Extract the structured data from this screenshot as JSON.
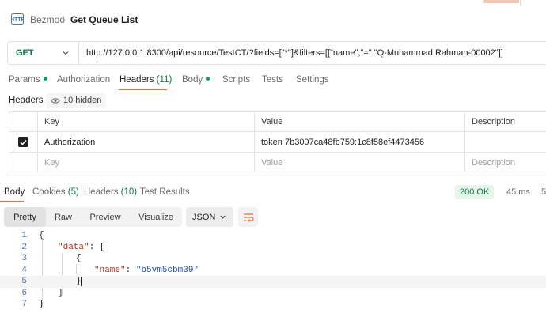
{
  "breadcrumb": {
    "workspace": "Bezmoo",
    "separator": "/",
    "title": "Get Queue List"
  },
  "request": {
    "method": "GET",
    "url": "http://127.0.0.1:8300/api/resource/TestCT/?fields=[\"*\"]&filters=[[\"name\",\"=\",\"Q-Muhammad Rahman-00002\"]]"
  },
  "request_tabs": {
    "params": "Params",
    "authorization": "Authorization",
    "headers": "Headers",
    "headers_count": "(11)",
    "body": "Body",
    "scripts": "Scripts",
    "tests": "Tests",
    "settings": "Settings"
  },
  "headers_section": {
    "label": "Headers",
    "hidden": "10 hidden",
    "columns": {
      "key": "Key",
      "value": "Value",
      "description": "Description"
    },
    "rows": [
      {
        "checked": true,
        "key": "Authorization",
        "value": "token 7b3007ca48fb759:1c8f58ef4473456",
        "description": ""
      }
    ],
    "new_row": {
      "key_placeholder": "Key",
      "value_placeholder": "Value",
      "description_placeholder": "Description"
    }
  },
  "response_tabs": {
    "body": "Body",
    "cookies": "Cookies",
    "cookies_count": "(5)",
    "headers": "Headers",
    "headers_count": "(10)",
    "test_results": "Test Results"
  },
  "response_meta": {
    "status": "200 OK",
    "time": "45 ms",
    "size": "5"
  },
  "viewer": {
    "modes": [
      "Pretty",
      "Raw",
      "Preview",
      "Visualize"
    ],
    "active_mode": "Pretty",
    "format": "JSON"
  },
  "code_lines": [
    {
      "n": "1",
      "text": "{"
    },
    {
      "n": "2",
      "key": "\"data\"",
      "rest": ": ["
    },
    {
      "n": "3",
      "text": "{"
    },
    {
      "n": "4",
      "key": "\"name\"",
      "rest": ": ",
      "value": "\"b5vm5cbm39\""
    },
    {
      "n": "5",
      "text": "}"
    },
    {
      "n": "6",
      "text": "]"
    },
    {
      "n": "7",
      "text": "}"
    }
  ],
  "icons": {
    "app": "http-request-icon",
    "method_dropdown": "chevron-down-icon",
    "hidden_toggle": "eye-icon",
    "checkbox": "checkmark-icon",
    "format_dropdown": "chevron-down-icon",
    "wrap": "wrap-lines-icon"
  },
  "colors": {
    "accent": "#ff6c37",
    "method_get": "#0b7a4b",
    "status_ok_bg": "#e6f4ea",
    "json_key": "#b5321e",
    "json_string": "#1f4eb8"
  }
}
